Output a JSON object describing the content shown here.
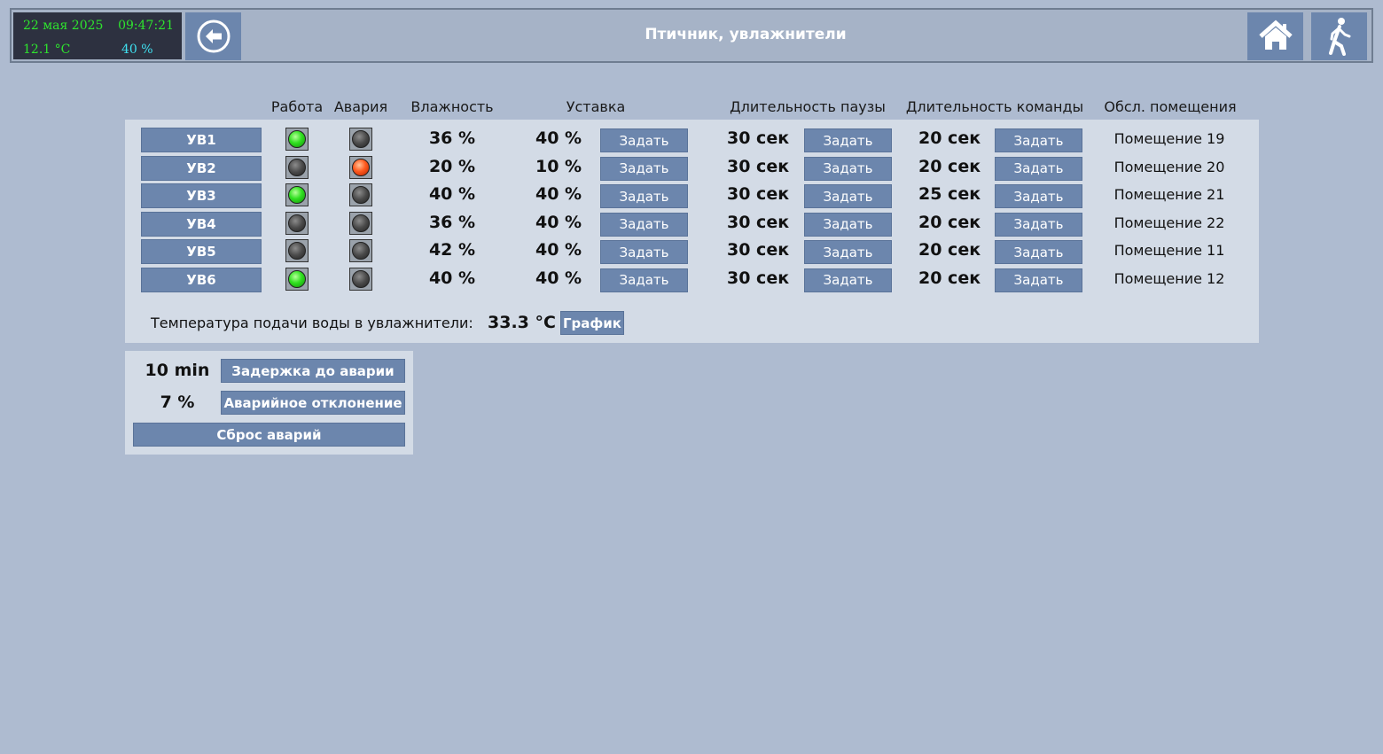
{
  "header": {
    "date": "22 мая 2025",
    "time": "09:47:21",
    "temperature": "12.1 °C",
    "humidity": "40 %",
    "title": "Птичник, увлажнители",
    "back_icon": "arrow-left-circle-icon",
    "home_icon": "home-icon",
    "exit_icon": "walking-person-icon"
  },
  "columns": {
    "work": "Работа",
    "alarm": "Авария",
    "humidity": "Влажность",
    "setpoint": "Уставка",
    "pause": "Длительность паузы",
    "command": "Длительность команды",
    "room": "Обсл. помещения"
  },
  "set_label": "Задать",
  "units": [
    {
      "name": "УВ1",
      "work": "green",
      "alarm": "off",
      "humidity": "36 %",
      "setpoint": "40 %",
      "pause": "30 сек",
      "command": "20 сек",
      "room": "Помещение 19"
    },
    {
      "name": "УВ2",
      "work": "off",
      "alarm": "red",
      "humidity": "20 %",
      "setpoint": "10 %",
      "pause": "30 сек",
      "command": "20 сек",
      "room": "Помещение 20"
    },
    {
      "name": "УВ3",
      "work": "green",
      "alarm": "off",
      "humidity": "40 %",
      "setpoint": "40 %",
      "pause": "30 сек",
      "command": "25 сек",
      "room": "Помещение 21"
    },
    {
      "name": "УВ4",
      "work": "off",
      "alarm": "off",
      "humidity": "36 %",
      "setpoint": "40 %",
      "pause": "30 сек",
      "command": "20 сек",
      "room": "Помещение 22"
    },
    {
      "name": "УВ5",
      "work": "off",
      "alarm": "off",
      "humidity": "42 %",
      "setpoint": "40 %",
      "pause": "30 сек",
      "command": "20 сек",
      "room": "Помещение 11"
    },
    {
      "name": "УВ6",
      "work": "green",
      "alarm": "off",
      "humidity": "40 %",
      "setpoint": "40 %",
      "pause": "30 сек",
      "command": "20 сек",
      "room": "Помещение 12"
    }
  ],
  "water": {
    "label": "Температура подачи воды в увлажнители:",
    "value": "33.3 °C",
    "graph_button": "График"
  },
  "alarm_settings": {
    "delay_value": "10 min",
    "delay_button": "Задержка до аварии",
    "deviation_value": "7 %",
    "deviation_button": "Аварийное отклонение",
    "reset_button": "Сброс аварий"
  },
  "colors": {
    "background": "#aebbd0",
    "panel": "#d3dbe6",
    "button": "#6c86ad",
    "lamp_green": "#30e020",
    "lamp_red": "#ff5a1e",
    "clock_text": "#2ee32e"
  }
}
